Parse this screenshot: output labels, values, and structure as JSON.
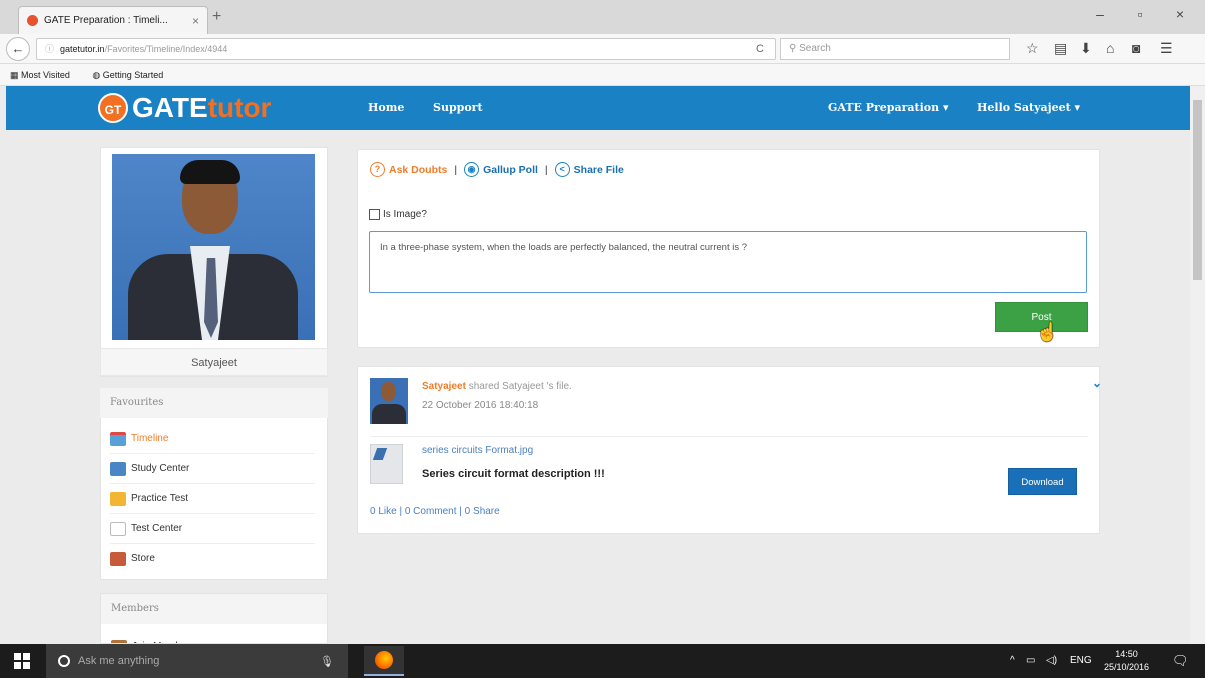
{
  "browser": {
    "tab_title": "GATE Preparation : Timeli...",
    "tab_close": "×",
    "new_tab": "+",
    "minimize": "–",
    "maximize": "▫",
    "close": "×",
    "back": "←",
    "info": "ⓘ",
    "url_domain": "gatetutor.in",
    "url_path": "/Favorites/Timeline/Index/4944",
    "reload": "C",
    "search_placeholder": "Search",
    "bookmarks": [
      "Most Visited",
      "Getting Started"
    ],
    "toolbar_icons": [
      "star-icon",
      "library-icon",
      "download-icon",
      "home-icon",
      "pocket-icon",
      "menu-icon"
    ]
  },
  "site": {
    "logo_badge": "GT",
    "logo_part1": "GATE",
    "logo_part2": "tutor",
    "nav": [
      "Home",
      "Support"
    ],
    "nav_right": [
      "GATE Preparation ▾",
      "Hello Satyajeet ▾"
    ],
    "brand_color": "#1a82c4",
    "accent_color": "#f36f21"
  },
  "sidebar": {
    "profile_name": "Satyajeet",
    "favourites_title": "Favourites",
    "favourites": [
      {
        "label": "Timeline",
        "icon": "calendar-icon",
        "active": true
      },
      {
        "label": "Study Center",
        "icon": "books-icon",
        "active": false
      },
      {
        "label": "Practice Test",
        "icon": "folder-icon",
        "active": false
      },
      {
        "label": "Test Center",
        "icon": "test-icon",
        "active": false
      },
      {
        "label": "Store",
        "icon": "store-icon",
        "active": false
      }
    ],
    "members_title": "Members",
    "members": [
      {
        "label": "Join Members",
        "icon": "members-icon"
      }
    ]
  },
  "composer": {
    "ask_doubts": "Ask Doubts",
    "gallup_poll": "Gallup Poll",
    "share_file": "Share File",
    "separator": "|",
    "is_image_label": "Is Image?",
    "text": "In a three-phase system, when the loads are perfectly balanced, the neutral current is ?",
    "post_button": "Post"
  },
  "feed": [
    {
      "author": "Satyajeet",
      "action": "shared Satyajeet 's file.",
      "date": "22 October 2016 18:40:18",
      "file_name": "series circuits Format.jpg",
      "description": "Series circuit format description !!!",
      "download_label": "Download",
      "stats": "0 Like | 0 Comment | 0 Share"
    }
  ],
  "taskbar": {
    "search_placeholder": "Ask me anything",
    "tray_caret": "^",
    "language": "ENG",
    "time": "14:50",
    "date": "25/10/2016"
  }
}
